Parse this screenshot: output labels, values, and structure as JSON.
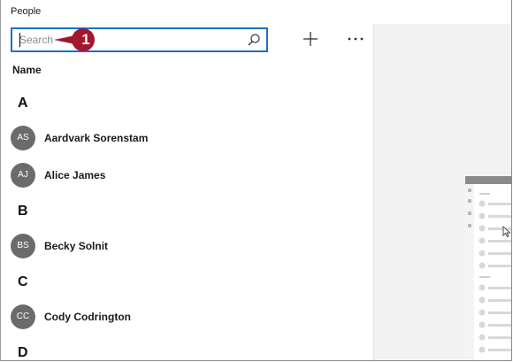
{
  "app": {
    "title": "People"
  },
  "search": {
    "placeholder": "Search"
  },
  "toolbar": {
    "add_icon": "plus-icon",
    "more_icon": "more-ellipsis-icon"
  },
  "callout": {
    "number": "1",
    "color": "#a3162f"
  },
  "list": {
    "sort_label": "Name",
    "groups": [
      {
        "letter": "A",
        "contacts": [
          {
            "initials": "AS",
            "name": "Aardvark Sorenstam"
          },
          {
            "initials": "AJ",
            "name": "Alice James"
          }
        ]
      },
      {
        "letter": "B",
        "contacts": [
          {
            "initials": "BS",
            "name": "Becky Solnit"
          }
        ]
      },
      {
        "letter": "C",
        "contacts": [
          {
            "initials": "CC",
            "name": "Cody Codrington"
          }
        ]
      },
      {
        "letter": "D",
        "contacts": []
      }
    ]
  },
  "colors": {
    "accent": "#1e6fc8",
    "avatar": "#6b6b6b",
    "right_pane": "#f2f2f2"
  }
}
